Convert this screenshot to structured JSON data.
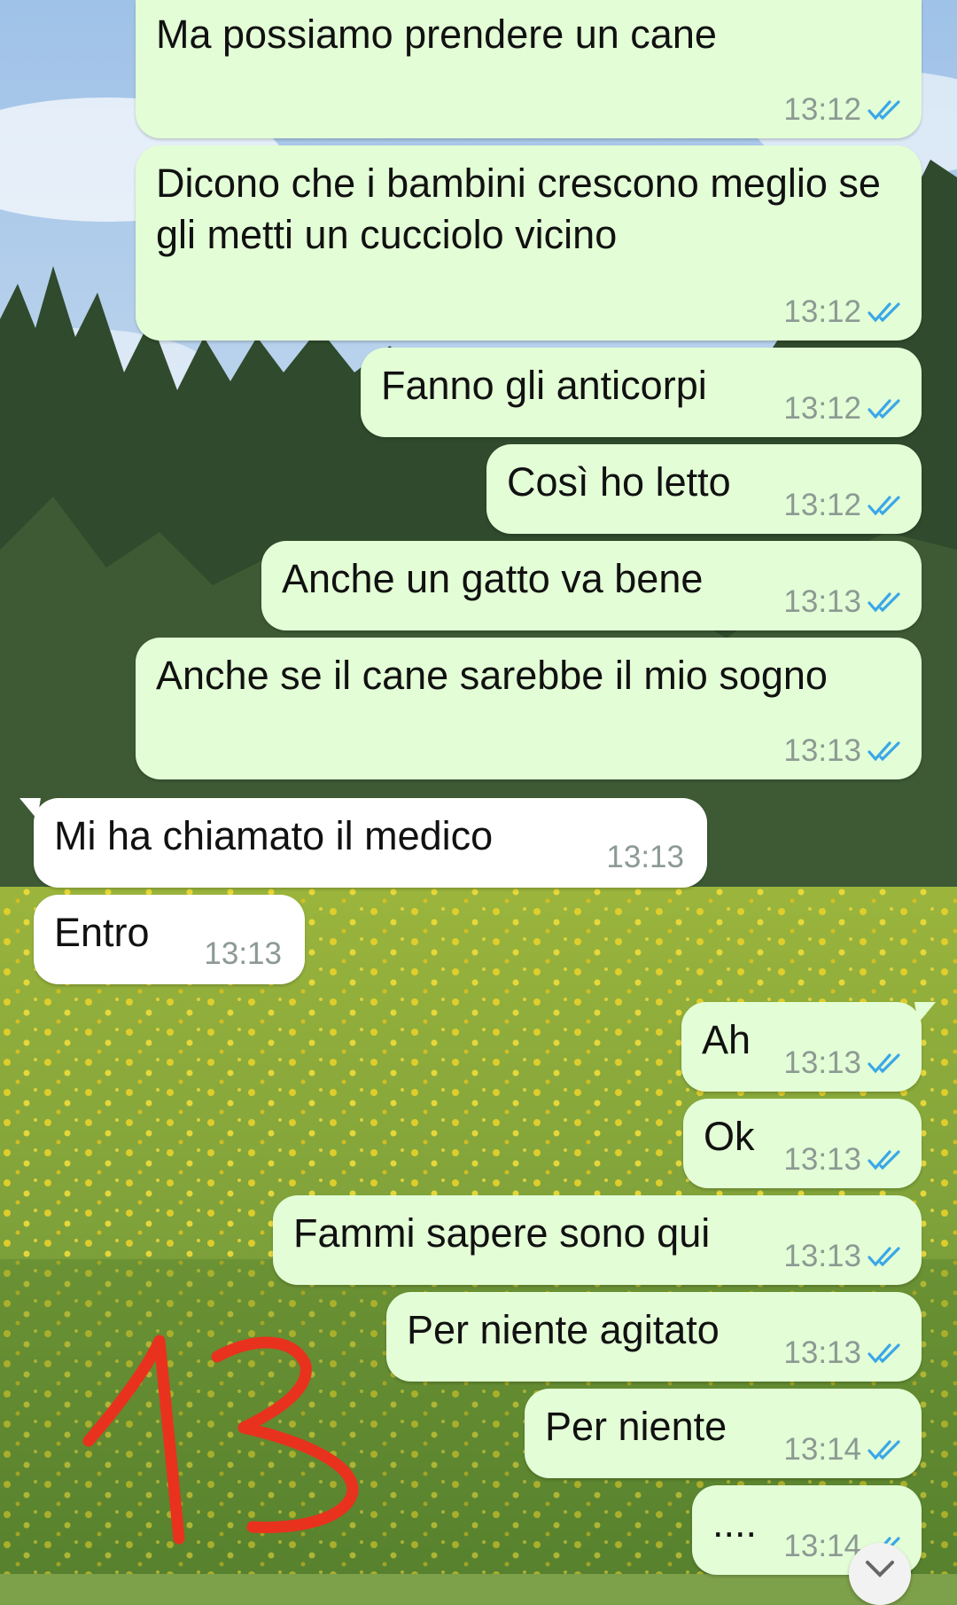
{
  "colors": {
    "outgoing_bubble": "#e3fed6",
    "incoming_bubble": "#ffffff",
    "read_ticks": "#3aa7e8",
    "annotation": "#e8321e"
  },
  "annotation": {
    "text": "13"
  },
  "messages": [
    {
      "dir": "out",
      "text": "Ma possiamo prendere un cane",
      "time": "13:12",
      "status": "read"
    },
    {
      "dir": "out",
      "text": "Dicono che i bambini crescono meglio se gli metti un cucciolo vicino",
      "time": "13:12",
      "status": "read"
    },
    {
      "dir": "out",
      "text": "Fanno gli anticorpi",
      "time": "13:12",
      "status": "read"
    },
    {
      "dir": "out",
      "text": "Così ho letto",
      "time": "13:12",
      "status": "read"
    },
    {
      "dir": "out",
      "text": "Anche un gatto va bene",
      "time": "13:13",
      "status": "read"
    },
    {
      "dir": "out",
      "text": "Anche se il cane sarebbe il mio sogno",
      "time": "13:13",
      "status": "read"
    },
    {
      "dir": "in",
      "text": "Mi ha chiamato il medico",
      "time": "13:13"
    },
    {
      "dir": "in",
      "text": "Entro",
      "time": "13:13"
    },
    {
      "dir": "out",
      "text": "Ah",
      "time": "13:13",
      "status": "read"
    },
    {
      "dir": "out",
      "text": "Ok",
      "time": "13:13",
      "status": "read"
    },
    {
      "dir": "out",
      "text": "Fammi sapere sono qui",
      "time": "13:13",
      "status": "read"
    },
    {
      "dir": "out",
      "text": "Per niente agitato",
      "time": "13:13",
      "status": "read"
    },
    {
      "dir": "out",
      "text": "Per niente",
      "time": "13:14",
      "status": "read"
    },
    {
      "dir": "out",
      "text": "....",
      "time": "13:14",
      "status": "read"
    }
  ],
  "icons": {
    "ticks": "double-check-icon",
    "scroll": "chevron-down-icon"
  }
}
